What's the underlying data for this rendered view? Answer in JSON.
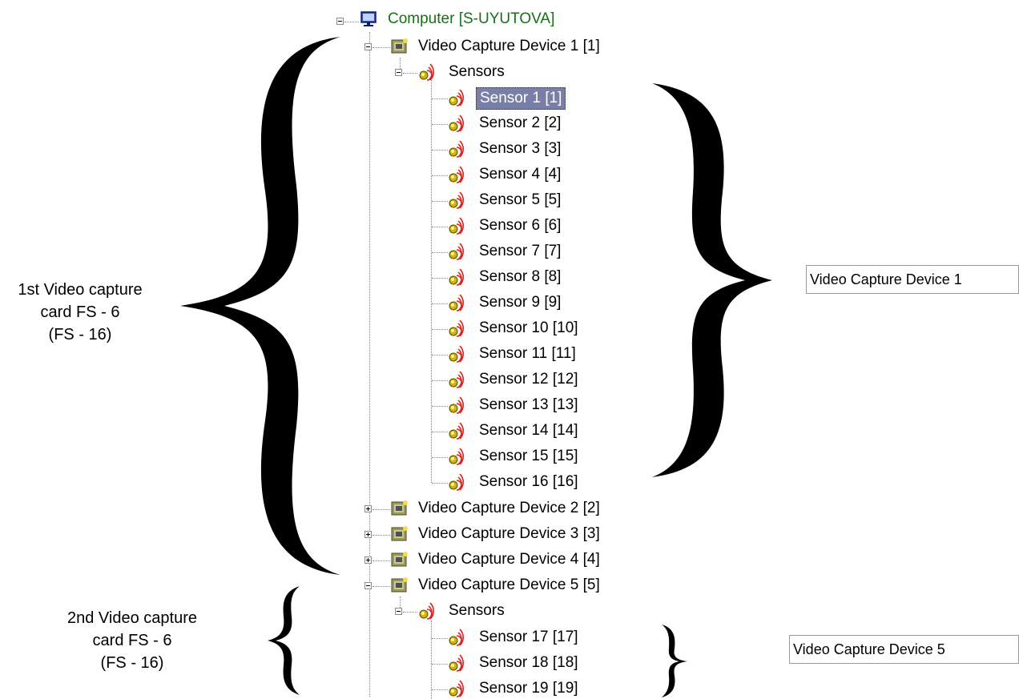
{
  "tree": {
    "computer": "Computer [S-UYUTOVA]",
    "device1": "Video Capture Device 1 [1]",
    "sensors_group1": "Sensors",
    "sensors1": [
      "Sensor 1 [1]",
      "Sensor 2 [2]",
      "Sensor 3 [3]",
      "Sensor 4 [4]",
      "Sensor 5 [5]",
      "Sensor 6 [6]",
      "Sensor 7 [7]",
      "Sensor 8 [8]",
      "Sensor 9 [9]",
      "Sensor 10 [10]",
      "Sensor 11 [11]",
      "Sensor 12 [12]",
      "Sensor 13 [13]",
      "Sensor 14 [14]",
      "Sensor 15 [15]",
      "Sensor 16 [16]"
    ],
    "device2": "Video Capture Device 2 [2]",
    "device3": "Video Capture Device 3 [3]",
    "device4": "Video Capture Device 4 [4]",
    "device5": "Video Capture Device 5 [5]",
    "sensors_group5": "Sensors",
    "sensors5": [
      "Sensor 17 [17]",
      "Sensor 18 [18]",
      "Sensor 19 [19]"
    ],
    "selected_sensor_index": 0
  },
  "annotations": {
    "card1_line1": "1st Video capture",
    "card1_line2": "card FS - 6",
    "card1_line3": "(FS - 16)",
    "card2_line1": "2nd Video capture",
    "card2_line2": "card FS - 6",
    "card2_line3": "(FS - 16)"
  },
  "fields": {
    "device1_name": "Video Capture Device 1",
    "device5_name": "Video Capture Device 5"
  },
  "colors": {
    "computer_label": "#1a6e1a",
    "selection": "#7a7fa8",
    "sensor_icon_red": "#e02020",
    "sensor_icon_yellow": "#d4b400"
  },
  "icons": {
    "computer": "monitor-icon",
    "device": "capture-card-icon",
    "sensor": "sensor-signal-icon"
  }
}
